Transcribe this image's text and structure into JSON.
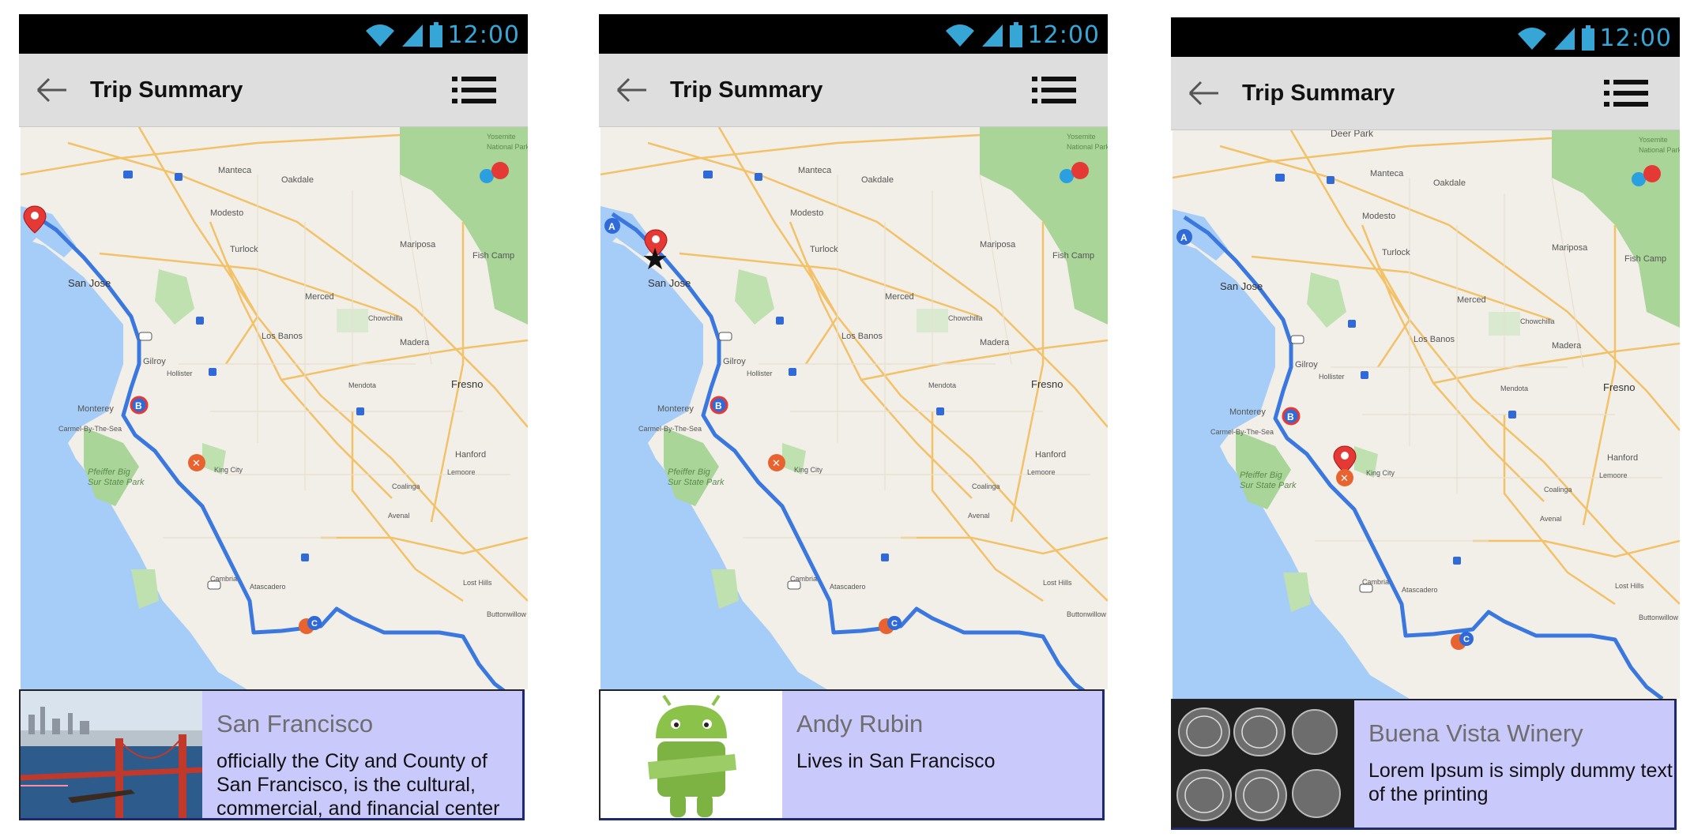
{
  "status_bar": {
    "time": "12:00",
    "icons": [
      "wifi-icon",
      "signal-icon",
      "battery-icon"
    ]
  },
  "app_bar": {
    "title": "Trip Summary",
    "back_icon": "arrow-left-icon",
    "menu_icon": "list-icon"
  },
  "map": {
    "labels": [
      "Manteca",
      "Oakdale",
      "Modesto",
      "Turlock",
      "Merced",
      "Mariposa",
      "Fish Camp",
      "San Jose",
      "Los Banos",
      "Madera",
      "Fresno",
      "Chowchilla",
      "Gilroy",
      "Hollister",
      "Mendota",
      "Monterey",
      "Carmel-By-The-Sea",
      "Pfeiffer Big Sur State Park",
      "King City",
      "Hanford",
      "Lemoore",
      "Coalinga",
      "Avenal",
      "Cambria",
      "Atascadero",
      "Lost Hills",
      "Buttonwillow",
      "Yosemite National Park",
      "Deer Park"
    ],
    "route_markers": [
      "A",
      "B",
      "C"
    ],
    "colors": {
      "water": "#a6cdf7",
      "land": "#f2efe9",
      "park": "#a9d598",
      "route": "#3a78e0",
      "marker": "#e53935"
    }
  },
  "screens": [
    {
      "card": {
        "title": "San Francisco",
        "description": "officially the City and County of San Francisco, is the cultural, commercial, and financial center",
        "image": "golden-gate-bridge-photo"
      }
    },
    {
      "card": {
        "title": "Andy Rubin",
        "description": "Lives in San Francisco",
        "image": "android-robot-image"
      }
    },
    {
      "card": {
        "title": "Buena Vista Winery",
        "description": "Lorem Ipsum is simply dummy text of the printing",
        "image": "wine-barrels-photo"
      }
    }
  ]
}
